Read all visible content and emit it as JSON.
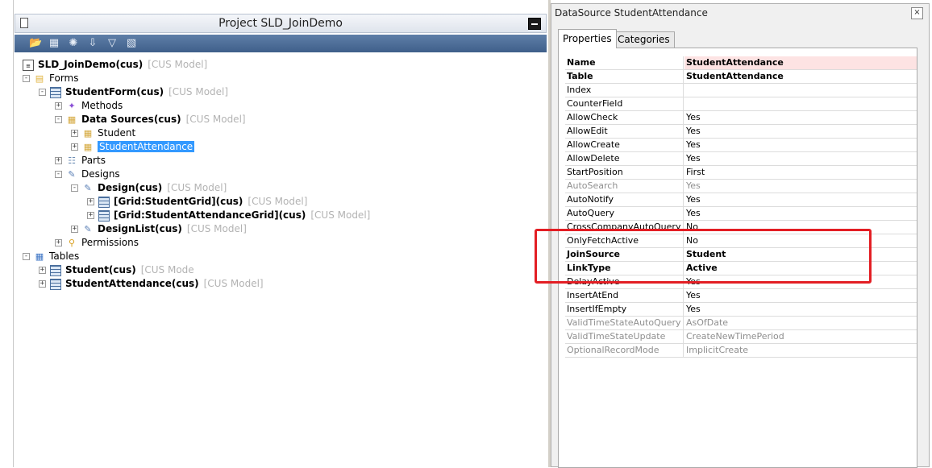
{
  "project": {
    "title": "Project SLD_JoinDemo",
    "toolbar_icons": [
      "open-icon",
      "save-icon",
      "compile-icon",
      "import-icon",
      "filter-icon",
      "layout-icon"
    ]
  },
  "tree": {
    "model_tag": "[CUS Model]",
    "model_tag_truncated": "[CUS Mode",
    "root": "SLD_JoinDemo(cus)",
    "forms": "Forms",
    "student_form": "StudentForm(cus)",
    "methods": "Methods",
    "data_sources": "Data Sources(cus)",
    "ds_student": "Student",
    "ds_attendance": "StudentAttendance",
    "parts": "Parts",
    "designs": "Designs",
    "design": "Design(cus)",
    "grid_student": "[Grid:StudentGrid](cus)",
    "grid_attendance": "[Grid:StudentAttendanceGrid](cus)",
    "design_list": "DesignList(cus)",
    "permissions": "Permissions",
    "tables": "Tables",
    "table_student": "Student(cus)",
    "table_attendance": "StudentAttendance(cus)"
  },
  "properties": {
    "title": "DataSource StudentAttendance",
    "close_label": "×",
    "tabs": [
      "Properties",
      "Categories"
    ],
    "rows": [
      {
        "name": "Name",
        "value": "StudentAttendance"
      },
      {
        "name": "Table",
        "value": "StudentAttendance"
      },
      {
        "name": "Index",
        "value": ""
      },
      {
        "name": "CounterField",
        "value": ""
      },
      {
        "name": "AllowCheck",
        "value": "Yes"
      },
      {
        "name": "AllowEdit",
        "value": "Yes"
      },
      {
        "name": "AllowCreate",
        "value": "Yes"
      },
      {
        "name": "AllowDelete",
        "value": "Yes"
      },
      {
        "name": "StartPosition",
        "value": "First"
      },
      {
        "name": "AutoSearch",
        "value": "Yes"
      },
      {
        "name": "AutoNotify",
        "value": "Yes"
      },
      {
        "name": "AutoQuery",
        "value": "Yes"
      },
      {
        "name": "CrossCompanyAutoQuery",
        "value": "No"
      },
      {
        "name": "OnlyFetchActive",
        "value": "No"
      },
      {
        "name": "JoinSource",
        "value": "Student"
      },
      {
        "name": "LinkType",
        "value": "Active"
      },
      {
        "name": "DelayActive",
        "value": "Yes"
      },
      {
        "name": "InsertAtEnd",
        "value": "Yes"
      },
      {
        "name": "InsertIfEmpty",
        "value": "Yes"
      },
      {
        "name": "ValidTimeStateAutoQuery",
        "value": "AsOfDate"
      },
      {
        "name": "ValidTimeStateUpdate",
        "value": "CreateNewTimePeriod"
      },
      {
        "name": "OptionalRecordMode",
        "value": "ImplicitCreate"
      }
    ]
  },
  "colors": {
    "selection": "#3399ff",
    "highlight_box": "#e31e24",
    "toolbar": "#4f6f99"
  }
}
